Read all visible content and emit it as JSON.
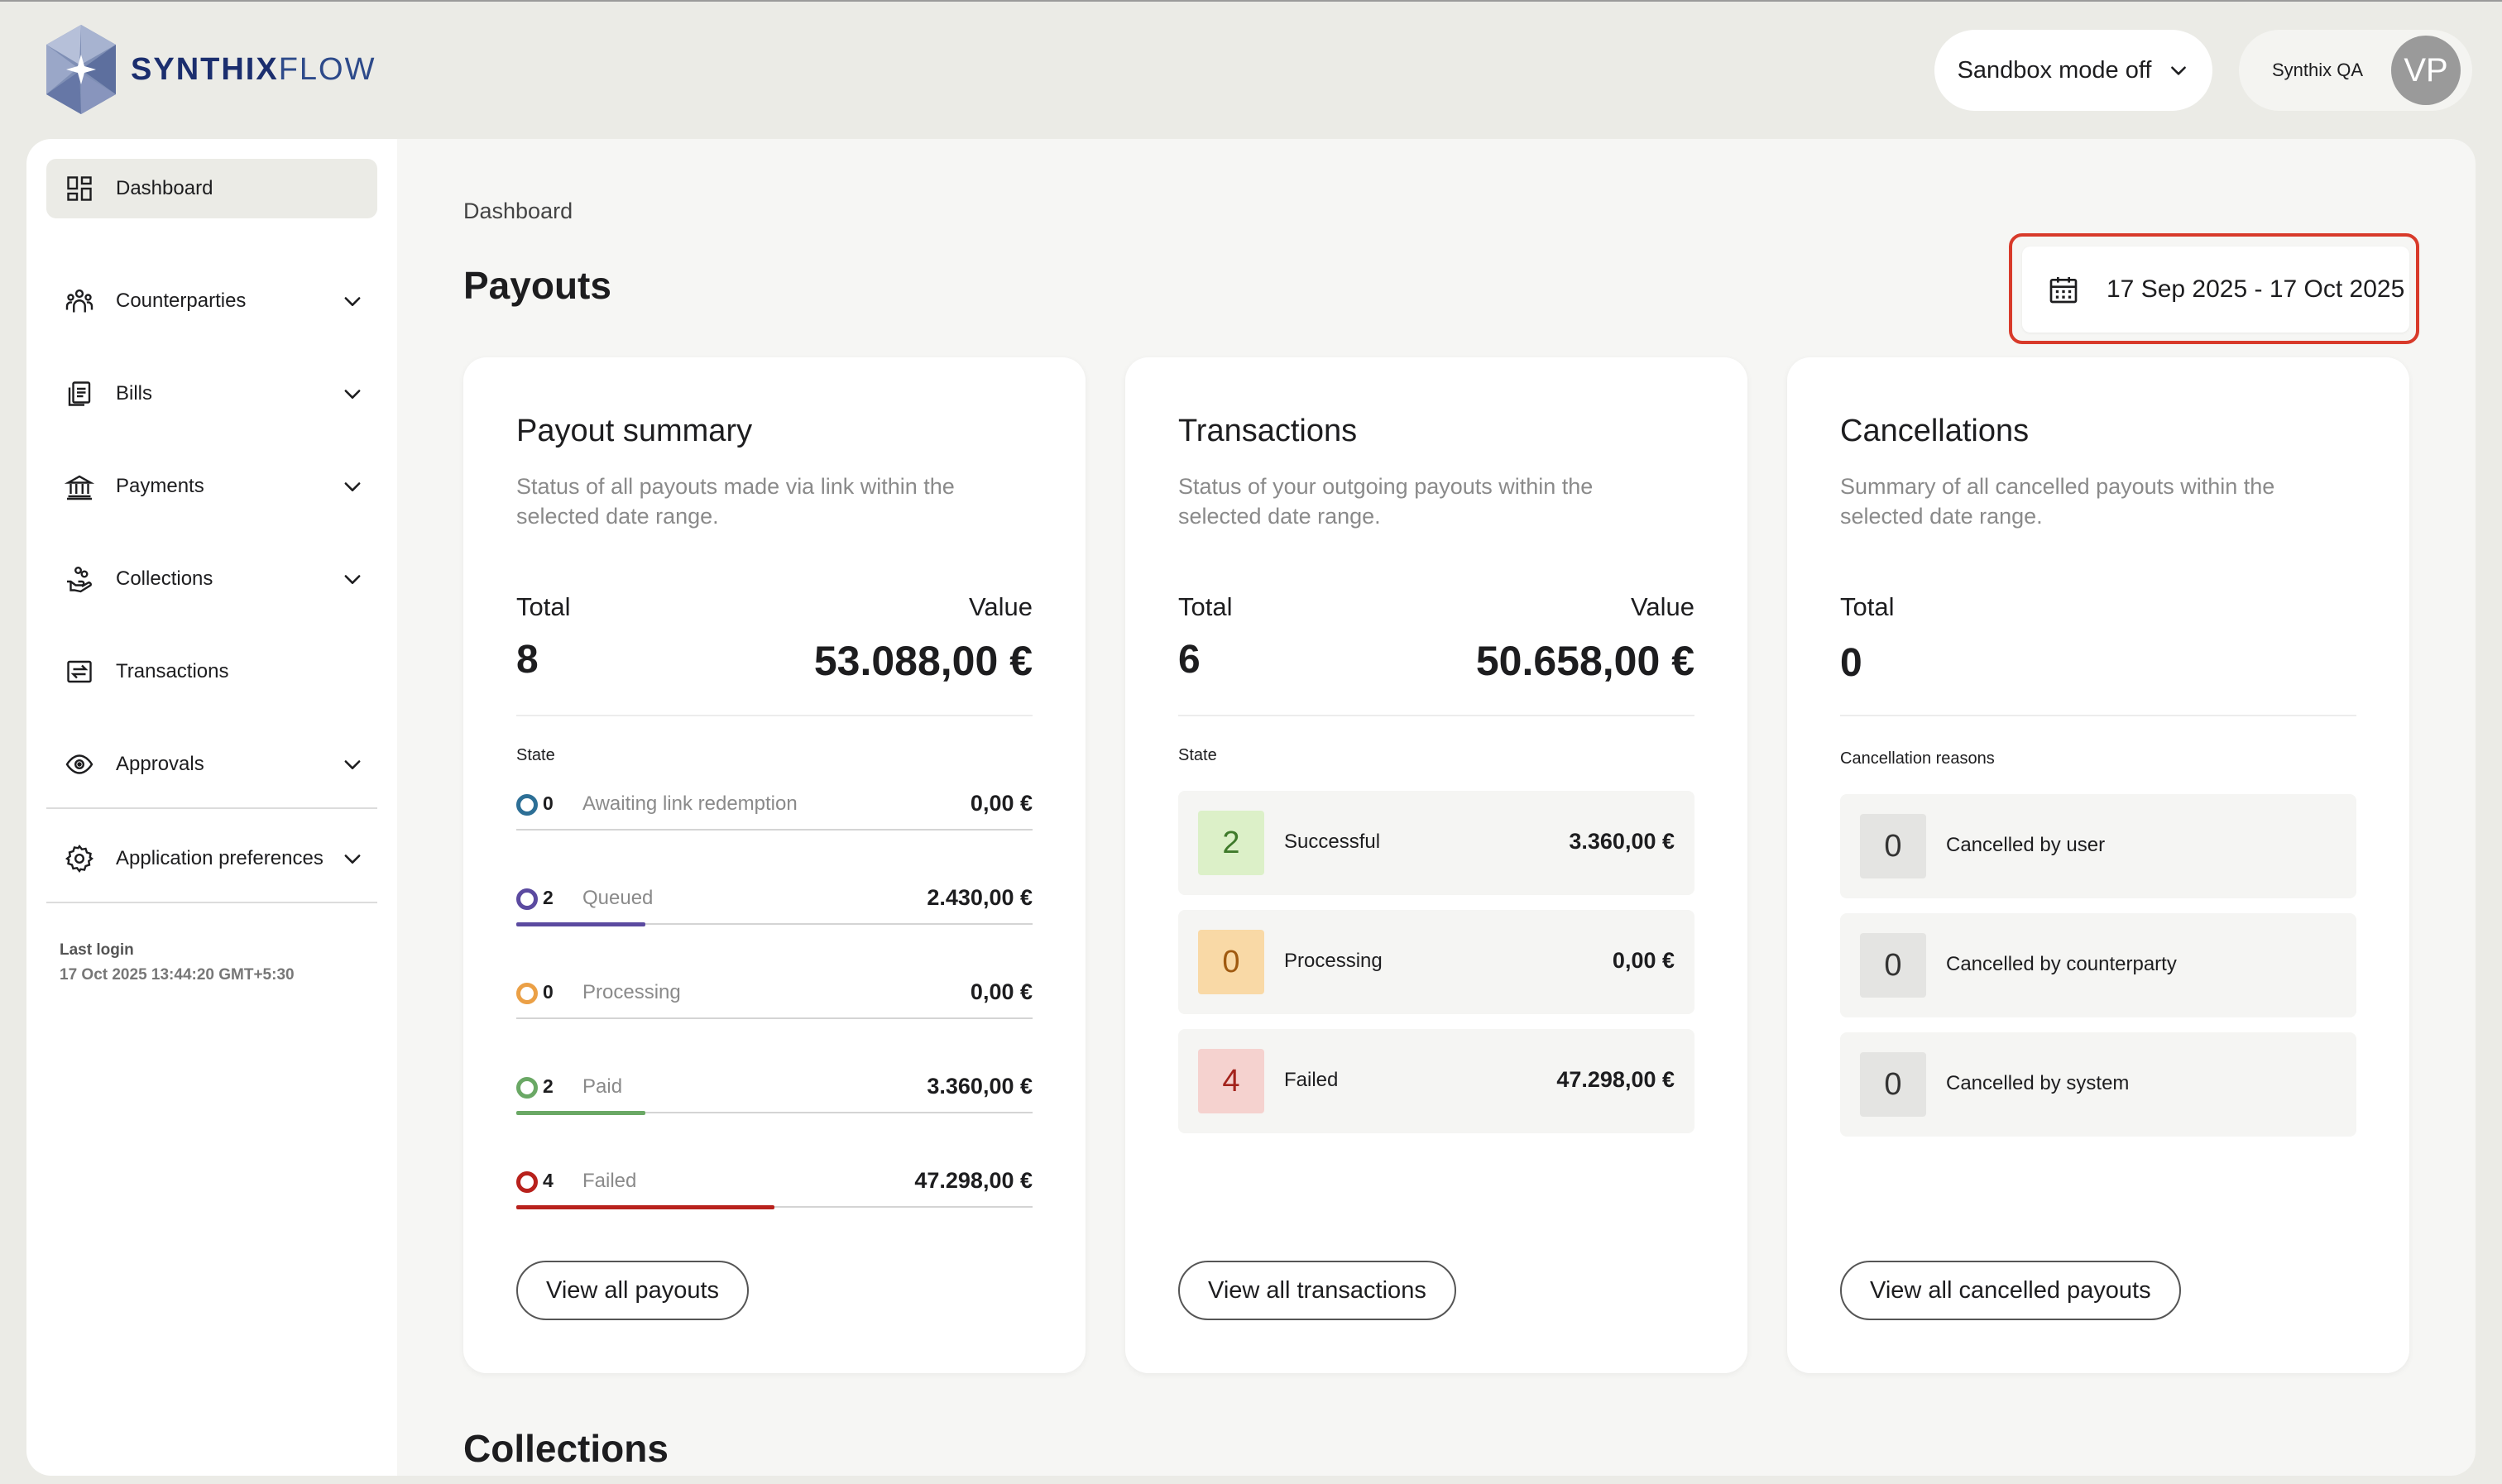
{
  "header": {
    "logo_bold": "SYNTHIX",
    "logo_light": "FLOW",
    "sandbox_label": "Sandbox mode off",
    "user_name": "Synthix QA",
    "avatar_initials": "VP"
  },
  "sidebar": {
    "items": [
      {
        "label": "Dashboard",
        "icon": "dashboard-icon"
      },
      {
        "label": "Counterparties",
        "icon": "people-icon"
      },
      {
        "label": "Bills",
        "icon": "bills-icon"
      },
      {
        "label": "Payments",
        "icon": "bank-icon"
      },
      {
        "label": "Collections",
        "icon": "hand-coins-icon"
      },
      {
        "label": "Transactions",
        "icon": "transfer-icon"
      },
      {
        "label": "Approvals",
        "icon": "eye-icon"
      },
      {
        "label": "Application preferences",
        "icon": "gear-icon"
      }
    ],
    "last_login_label": "Last login",
    "last_login_value": "17 Oct 2025 13:44:20 GMT+5:30"
  },
  "main": {
    "breadcrumb": "Dashboard",
    "title": "Payouts",
    "date_range": "17 Sep 2025 - 17 Oct 2025",
    "next_section": "Collections"
  },
  "payout_summary": {
    "title": "Payout summary",
    "description": "Status of all payouts made via link within the selected date range.",
    "total_label": "Total",
    "value_label": "Value",
    "total": "8",
    "value": "53.088,00 €",
    "state_label": "State",
    "rows": [
      {
        "count": "0",
        "name": "Awaiting link redemption",
        "amount": "0,00 €",
        "color": "#2d6f96",
        "fill": 0
      },
      {
        "count": "2",
        "name": "Queued",
        "amount": "2.430,00 €",
        "color": "#5b4aa0",
        "fill": 0.25
      },
      {
        "count": "0",
        "name": "Processing",
        "amount": "0,00 €",
        "color": "#eba046",
        "fill": 0
      },
      {
        "count": "2",
        "name": "Paid",
        "amount": "3.360,00 €",
        "color": "#6aa865",
        "fill": 0.25
      },
      {
        "count": "4",
        "name": "Failed",
        "amount": "47.298,00 €",
        "color": "#b8211c",
        "fill": 0.5
      }
    ],
    "button": "View all payouts"
  },
  "transactions": {
    "title": "Transactions",
    "description": "Status of your outgoing payouts within the selected date range.",
    "total_label": "Total",
    "value_label": "Value",
    "total": "6",
    "value": "50.658,00 €",
    "state_label": "State",
    "rows": [
      {
        "count": "2",
        "name": "Successful",
        "amount": "3.360,00 €",
        "bg": "#dcf0c8",
        "fg": "#3f7a2b"
      },
      {
        "count": "0",
        "name": "Processing",
        "amount": "0,00 €",
        "bg": "#f9d9a6",
        "fg": "#a05a10"
      },
      {
        "count": "4",
        "name": "Failed",
        "amount": "47.298,00 €",
        "bg": "#f5d2cf",
        "fg": "#a3231c"
      }
    ],
    "button": "View all transactions"
  },
  "cancellations": {
    "title": "Cancellations",
    "description": "Summary of all cancelled payouts within the selected date range.",
    "total_label": "Total",
    "total": "0",
    "reasons_label": "Cancellation reasons",
    "rows": [
      {
        "count": "0",
        "name": "Cancelled by user"
      },
      {
        "count": "0",
        "name": "Cancelled by counterparty"
      },
      {
        "count": "0",
        "name": "Cancelled by system"
      }
    ],
    "button": "View all cancelled payouts"
  },
  "colors": {
    "accent_highlight": "#d83a2a",
    "brand": "#1b2e6e"
  }
}
